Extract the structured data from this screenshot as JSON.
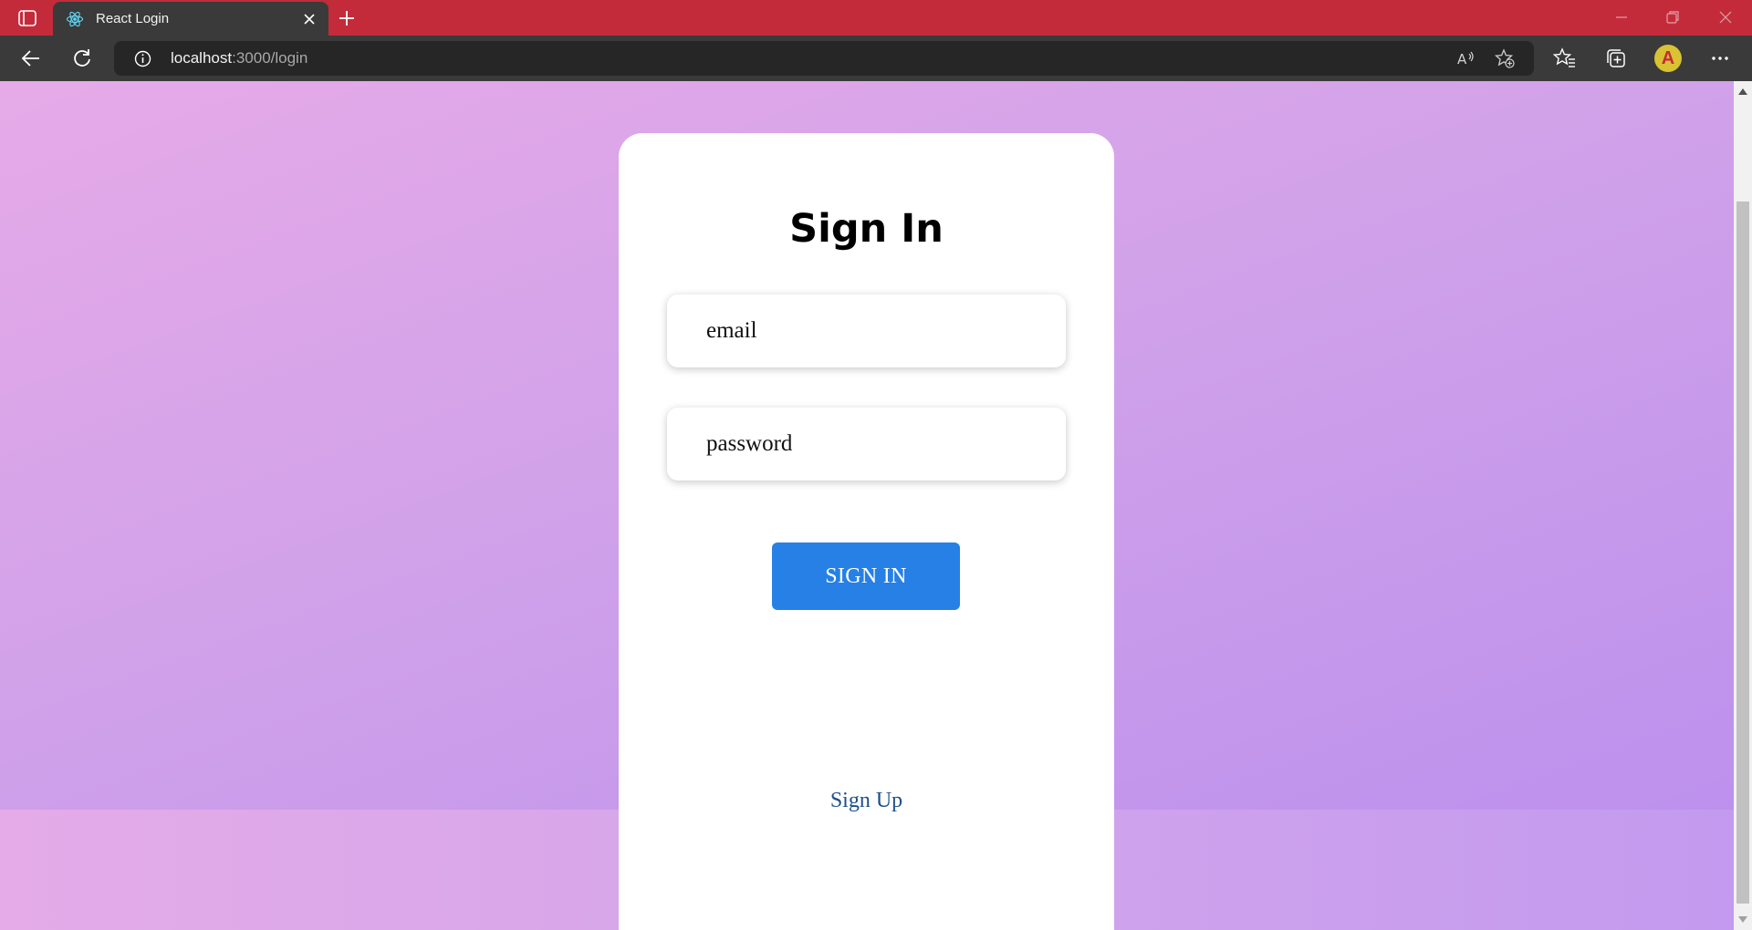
{
  "browser": {
    "tab": {
      "title": "React Login",
      "favicon": "react-icon"
    },
    "address": {
      "host": "localhost",
      "rest": ":3000/login"
    },
    "profile_initial": "A",
    "icons": {
      "tab_actions": "tab-actions-icon",
      "new_tab": "plus-icon",
      "back": "back-arrow-icon",
      "refresh": "refresh-icon",
      "site_info": "info-icon",
      "read_aloud": "read-aloud-icon",
      "add_favorite": "add-favorite-icon",
      "favorites": "favorites-icon",
      "collections": "collections-icon",
      "more": "more-icon"
    },
    "colors": {
      "tabstrip": "#c42b3a",
      "toolbar": "#3a3a3a",
      "avatar": "#d9c233"
    }
  },
  "login": {
    "title": "Sign In",
    "email_placeholder": "email",
    "password_placeholder": "password",
    "submit_label": "SIGN IN",
    "signup_link": "Sign Up"
  },
  "colors": {
    "accent": "#2680e5",
    "link": "#1e4f8a",
    "background_start": "#e6aae8",
    "background_end": "#b98eee"
  }
}
